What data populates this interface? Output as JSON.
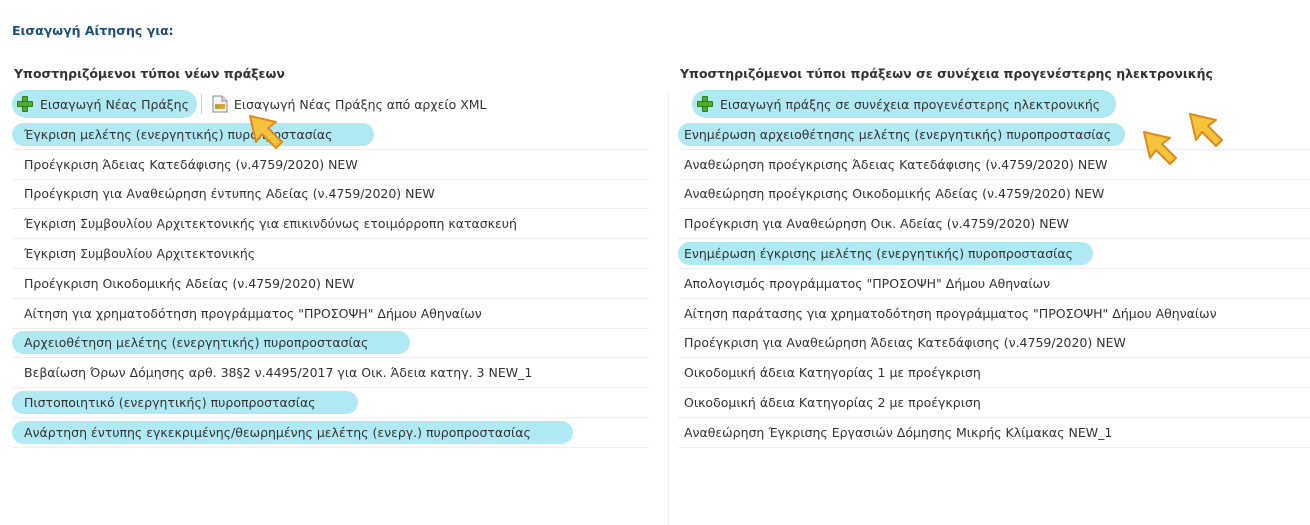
{
  "page": {
    "title": "Εισαγωγή Αίτησης για:"
  },
  "left": {
    "header": "Υποστηριζόμενοι τύποι νέων πράξεων",
    "toolbar": {
      "new_act": "Εισαγωγή Νέας Πράξης",
      "new_act_xml": "Εισαγωγή Νέας Πράξης από αρχείο XML"
    },
    "items": [
      "Έγκριση μελέτης (ενεργητικής) πυροπροστασίας",
      "Προέγκριση Άδειας Κατεδάφισης (ν.4759/2020) NEW",
      "Προέγκριση για Αναθεώρηση έντυπης Αδείας (ν.4759/2020) NEW",
      "Έγκριση Συμβουλίου Αρχιτεκτονικής για επικινδύνως ετοιμόρροπη κατασκευή",
      "Έγκριση Συμβουλίου Αρχιτεκτονικής",
      "Προέγκριση Οικοδομικής Αδείας (ν.4759/2020) NEW",
      "Αίτηση για χρηματοδότηση προγράμματος \"ΠΡΟΣΟΨΗ\" Δήμου Αθηναίων",
      "Αρχειοθέτηση μελέτης (ενεργητικής) πυροπροστασίας",
      "Βεβαίωση Όρων Δόμησης αρθ. 38§2 ν.4495/2017 για Οικ. Άδεια κατηγ. 3 NEW_1",
      "Πιστοποιητικό (ενεργητικής) πυροπροστασίας",
      "Ανάρτηση έντυπης εγκεκριμένης/θεωρημένης μελέτης (ενεργ.) πυροπροστασίας"
    ]
  },
  "right": {
    "header": "Υποστηριζόμενοι τύποι πράξεων σε συνέχεια προγενέστερης ηλεκτρονικής",
    "toolbar": {
      "continuation_act": "Εισαγωγή πράξης σε συνέχεια προγενέστερης ηλεκτρονικής"
    },
    "items": [
      "Ενημέρωση αρχειοθέτησης μελέτης (ενεργητικής) πυροπροστασίας",
      "Αναθεώρηση προέγκρισης Άδειας Κατεδάφισης (ν.4759/2020) NEW",
      "Αναθεώρηση προέγκρισης Οικοδομικής Αδείας (ν.4759/2020) NEW",
      "Προέγκριση για Αναθεώρηση Οικ. Αδείας (ν.4759/2020) NEW",
      "Ενημέρωση έγκρισης μελέτης (ενεργητικής) πυροπροστασίας",
      "Απολογισμός προγράμματος \"ΠΡΟΣΟΨΗ\" Δήμου Αθηναίων",
      "Αίτηση παράτασης για χρηματοδότηση προγράμματος \"ΠΡΟΣΟΨΗ\" Δήμου Αθηναίων",
      "Προέγκριση για Αναθεώρηση Άδειας Κατεδάφισης (ν.4759/2020) NEW",
      "Οικοδομική άδεια Κατηγορίας 1 με προέγκριση",
      "Οικοδομική άδεια Κατηγορίας 2 με προέγκριση",
      "Αναθεώρηση Έγκρισης Εργασιών Δόμησης Μικρής Κλίμακας NEW_1"
    ]
  },
  "icons": {
    "add": "plus-icon",
    "xml": "xml-file-icon",
    "pointer": "pointing-arrow-icon"
  },
  "colors": {
    "title": "#1f4e79",
    "highlight": "#aee9f4",
    "text": "#333333",
    "arrow_fill": "#f7c23c",
    "arrow_stroke": "#e08a1a"
  }
}
